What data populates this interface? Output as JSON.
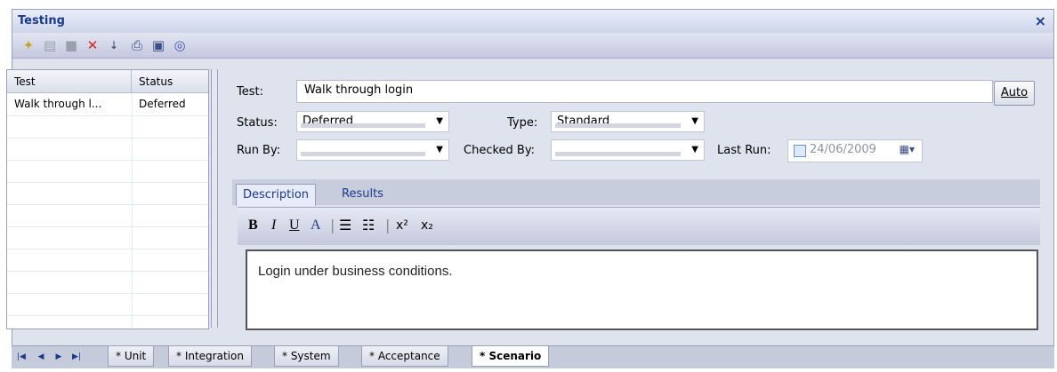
{
  "window": {
    "title": "Testing",
    "close_glyph": "×"
  },
  "toolbar": {
    "icons": [
      "new-icon",
      "save-icon",
      "copy-icon",
      "delete-icon",
      "sort-icon",
      "print-icon",
      "properties-icon",
      "help-icon"
    ]
  },
  "list": {
    "columns": [
      "Test",
      "Status"
    ],
    "rows": [
      {
        "test": "Walk through l...",
        "status": "Deferred"
      }
    ]
  },
  "form": {
    "test_label": "Test:",
    "test_value": "Walk through login",
    "auto_button": "Auto",
    "status_label": "Status:",
    "status_value": "Deferred",
    "type_label": "Type:",
    "type_value": "Standard",
    "runby_label": "Run By:",
    "runby_value": "",
    "checkedby_label": "Checked By:",
    "checkedby_value": "",
    "lastrun_label": "Last Run:",
    "lastrun_value": "24/06/2009"
  },
  "tabs": {
    "description": "Description",
    "results": "Results"
  },
  "format": {
    "bold": "B",
    "italic": "I",
    "underline": "U",
    "font": "A",
    "superscript": "x²",
    "subscript": "x₂"
  },
  "editor": {
    "text": "Login under business conditions."
  },
  "bottom_tabs": [
    "* Unit",
    "* Integration",
    "* System",
    "* Acceptance",
    "* Scenario"
  ],
  "bottom_active": "* Scenario",
  "colors": {
    "title": "#1c3a8a",
    "delete": "#d3261f"
  }
}
